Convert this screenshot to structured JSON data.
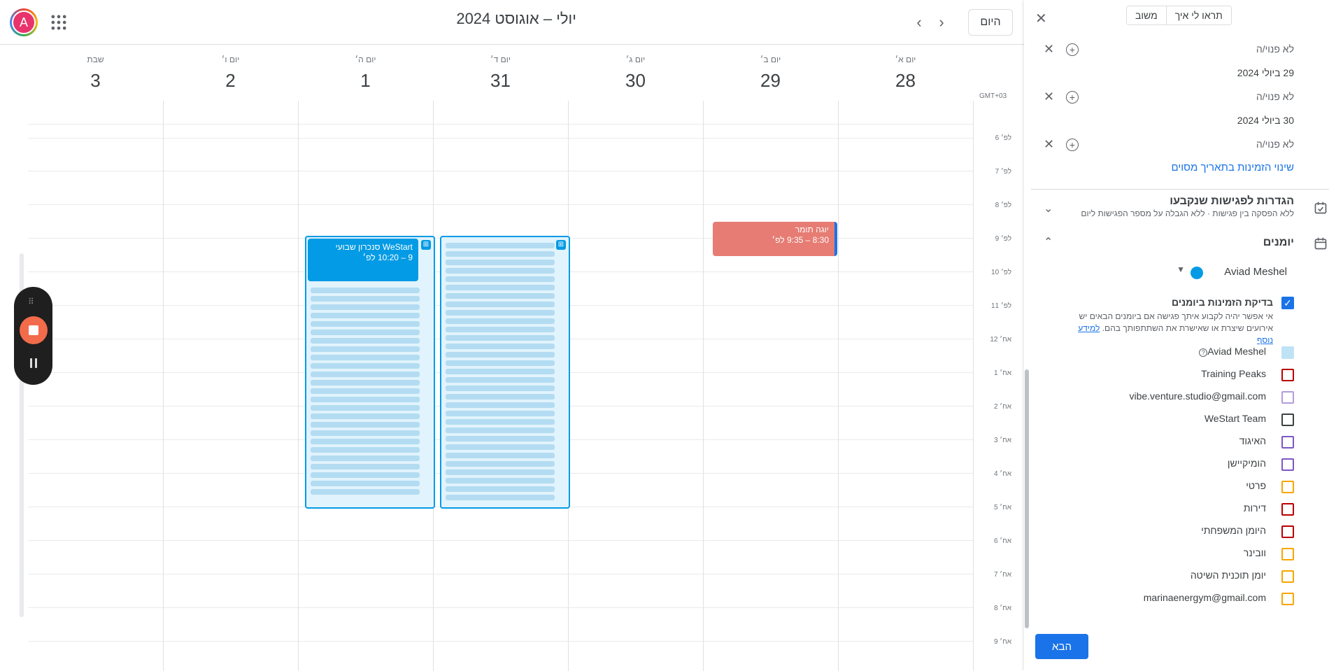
{
  "header": {
    "avatar_letter": "A",
    "title": "יולי – אוגוסט 2024",
    "today_label": "היום",
    "prev_icon": "chevron-right-icon",
    "next_icon": "chevron-left-icon",
    "apps_icon": "apps-grid-icon"
  },
  "days": [
    {
      "name": "יום א׳",
      "num": "28"
    },
    {
      "name": "יום ב׳",
      "num": "29"
    },
    {
      "name": "יום ג׳",
      "num": "30"
    },
    {
      "name": "יום ד׳",
      "num": "31"
    },
    {
      "name": "יום ה׳",
      "num": "1"
    },
    {
      "name": "יום ו׳",
      "num": "2"
    },
    {
      "name": "שבת",
      "num": "3"
    }
  ],
  "timezone": "GMT+03",
  "time_labels": [
    "6 לפ׳",
    "7 לפ׳",
    "8 לפ׳",
    "9 לפ׳",
    "10 לפ׳",
    "11 לפ׳",
    "12 אח׳",
    "1 אח׳",
    "2 אח׳",
    "3 אח׳",
    "4 אח׳",
    "5 אח׳",
    "6 אח׳",
    "7 אח׳",
    "8 אח׳",
    "9 אח׳"
  ],
  "events": {
    "yoga": {
      "title": "יוגה תומר",
      "time": "8:30 – 9:35 לפ׳",
      "color": "#e67c73"
    },
    "sync": {
      "title": "WeStart סנכרון שבועי",
      "time": "9 – 10:20 לפ׳",
      "color": "#039be5"
    }
  },
  "panel": {
    "btn_show_how": "תראו לי איך",
    "btn_feedback": "משוב",
    "unavailable": "לא פנוי/ה",
    "date_1": "29 ביולי 2024",
    "date_2": "30 ביולי 2024",
    "change_availability_link": "שינוי הזמינות בתאריך מסוים",
    "booked_settings_title": "הגדרות לפגישות שנקבעו",
    "booked_settings_sub": "ללא הפסקה בין פגישות · ללא הגבלה על מספר הפגישות ליום",
    "calendars_title": "יומנים",
    "owner_name": "Aviad Meshel",
    "check_availability_label": "בדיקת הזמינות ביומנים",
    "check_availability_desc": "אי אפשר יהיה לקבוע איתך פגישה אם ביומנים הבאים יש אירועים שיצרת או שאישרת את השתתפותך בהם.",
    "learn_more": "למידע נוסף",
    "next_label": "הבא",
    "calendars": [
      {
        "name": "Aviad Meshel",
        "color": "#bfe3f5"
      },
      {
        "name": "Training Peaks",
        "color": "#b80000"
      },
      {
        "name": "vibe.venture.studio@gmail.com",
        "color": "#b39ddb"
      },
      {
        "name": "WeStart Team",
        "color": "#3c4043"
      },
      {
        "name": "האיגוד",
        "color": "#7e57c2"
      },
      {
        "name": "הומיקיישן",
        "color": "#7e57c2"
      },
      {
        "name": "פרטי",
        "color": "#f6a600"
      },
      {
        "name": "דירות",
        "color": "#b80000"
      },
      {
        "name": "היומן המשפחתי",
        "color": "#b80000"
      },
      {
        "name": "וובינר",
        "color": "#f6a600"
      },
      {
        "name": "יומן תוכנית השיטה",
        "color": "#f6a600"
      },
      {
        "name": "marinaenergym@gmail.com",
        "color": "#f6a600"
      }
    ]
  }
}
